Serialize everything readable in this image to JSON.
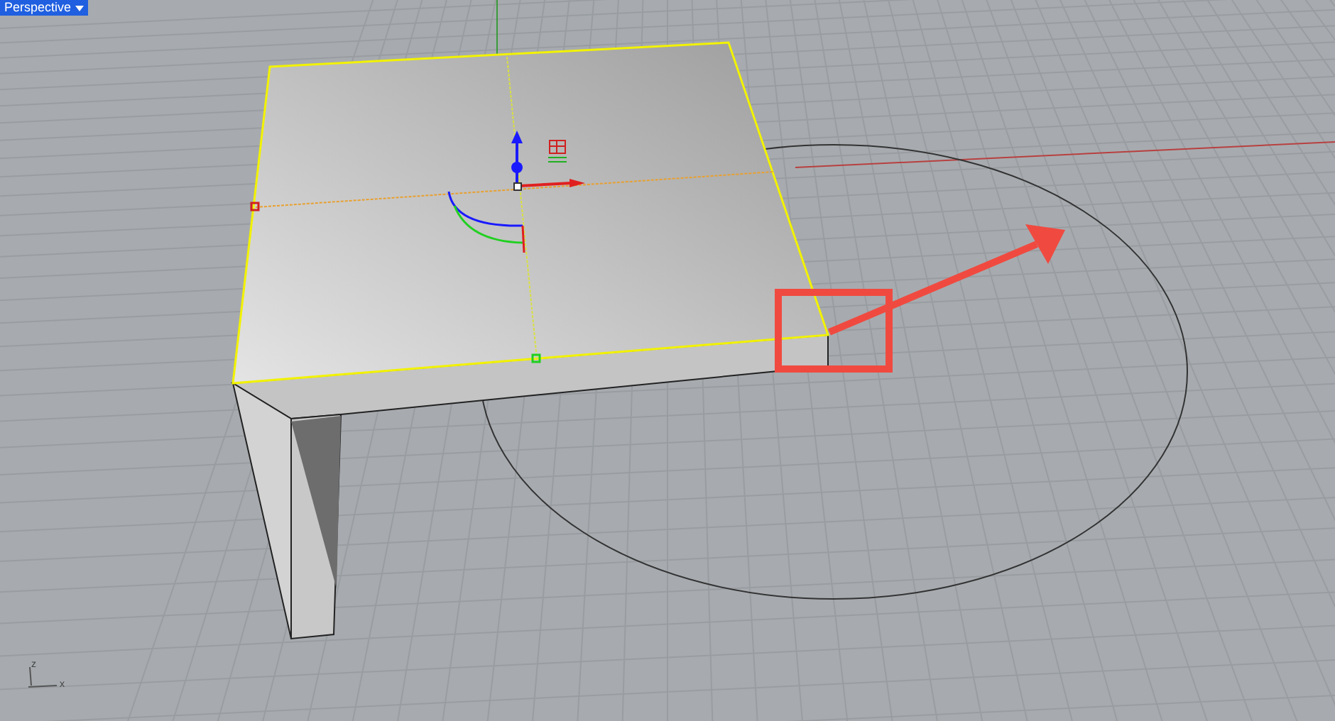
{
  "viewport": {
    "title": "Perspective",
    "axis_labels": [
      "z",
      "x"
    ]
  }
}
